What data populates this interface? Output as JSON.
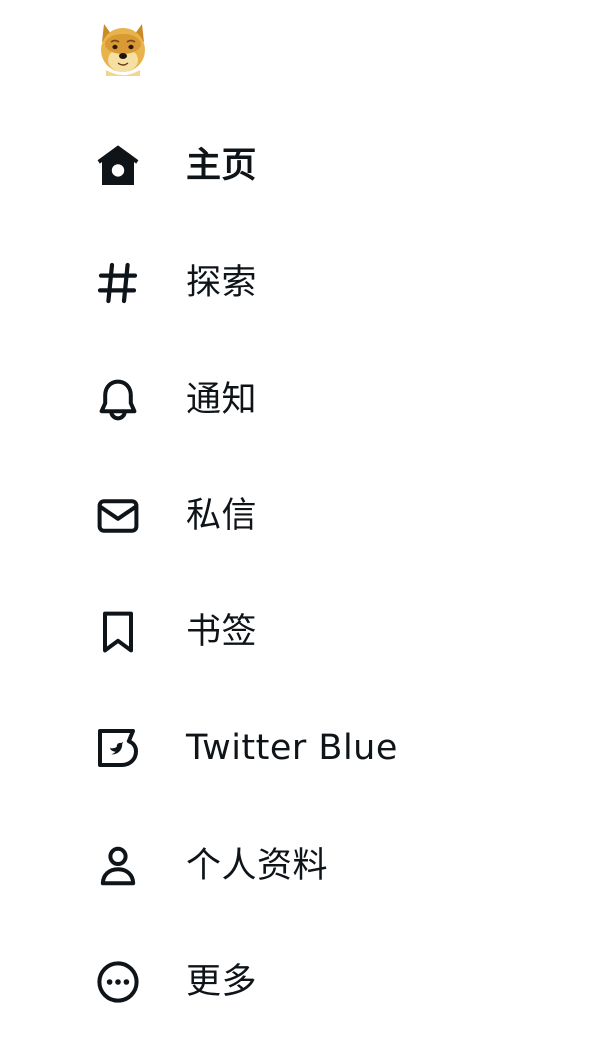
{
  "app": {
    "logo_icon": "doge-avatar-icon"
  },
  "nav": {
    "items": [
      {
        "id": "home",
        "label": "主页",
        "icon": "home-icon",
        "active": true
      },
      {
        "id": "explore",
        "label": "探索",
        "icon": "hashtag-icon",
        "active": false
      },
      {
        "id": "notifications",
        "label": "通知",
        "icon": "bell-icon",
        "active": false
      },
      {
        "id": "messages",
        "label": "私信",
        "icon": "envelope-icon",
        "active": false
      },
      {
        "id": "bookmarks",
        "label": "书签",
        "icon": "bookmark-icon",
        "active": false
      },
      {
        "id": "twitter-blue",
        "label": "Twitter Blue",
        "icon": "twitter-blue-icon",
        "active": false
      },
      {
        "id": "profile",
        "label": "个人资料",
        "icon": "person-icon",
        "active": false
      },
      {
        "id": "more",
        "label": "更多",
        "icon": "more-circle-icon",
        "active": false
      }
    ]
  },
  "colors": {
    "text": "#0f1419",
    "logo_fur": "#e8b34a",
    "background": "#ffffff"
  }
}
